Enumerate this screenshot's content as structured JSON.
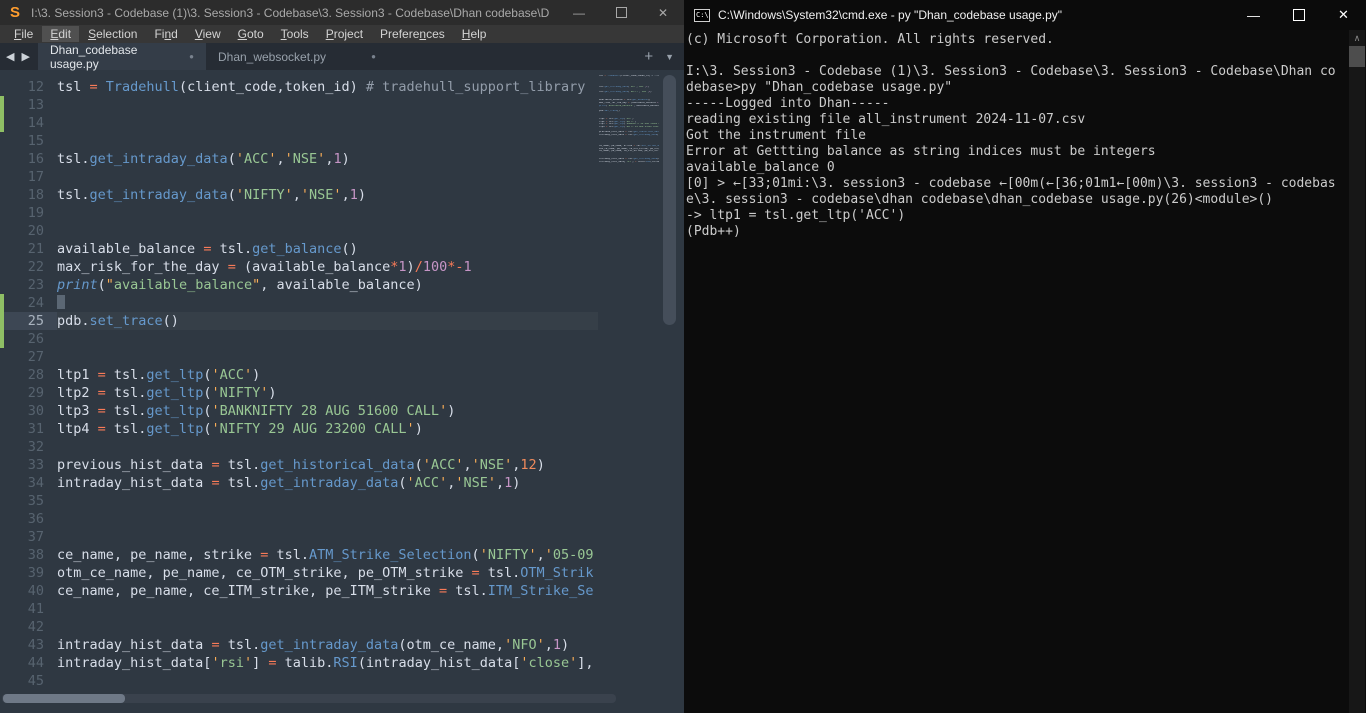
{
  "colors": {
    "editor_bg": "#2f3842",
    "editor_fg": "#d8dee9",
    "titlebar_bg": "#2c2c2c",
    "menubar_bg": "#373737",
    "menu_hl": "#505050",
    "tabbar_bg": "#262c34",
    "tab_active_bg": "#343d48",
    "tab_active_fg": "#e2e6ea",
    "tab_inactive_fg": "#98a1ab",
    "sublime_orange": "#ff9d2e",
    "fn_blue": "#6699cc",
    "string_green": "#99c794",
    "quote_orange": "#f9ae58",
    "operator_red": "#f97b58",
    "number_purple": "#c695c6",
    "number_orange": "#f08a5c",
    "comment_gray": "#939daa",
    "line_number": "#57636f",
    "gutter_green": "#8fbf65",
    "caret_gray": "#5b6774",
    "term_bg": "#0c0c0c",
    "term_fg": "#cccccc"
  },
  "editor_window": {
    "title": "I:\\3. Session3 - Codebase (1)\\3. Session3 - Codebase\\3. Session3 - Codebase\\Dhan codebase\\Dh...",
    "controls": {
      "minimize": "—",
      "maximize": "□",
      "close": "✕"
    },
    "menu": [
      {
        "label": "File",
        "u": 0
      },
      {
        "label": "Edit",
        "u": 0,
        "active": true
      },
      {
        "label": "Selection",
        "u": 0
      },
      {
        "label": "Find",
        "u": 2
      },
      {
        "label": "View",
        "u": 0
      },
      {
        "label": "Goto",
        "u": 0
      },
      {
        "label": "Tools",
        "u": 0
      },
      {
        "label": "Project",
        "u": 0
      },
      {
        "label": "Preferences",
        "u": 7
      },
      {
        "label": "Help",
        "u": 0
      }
    ],
    "nav_arrows": "◀ ▶",
    "tabs": [
      {
        "label": "Dhan_codebase usage.py",
        "modified_dot": "●",
        "active": true,
        "width": 168
      },
      {
        "label": "Dhan_websocket.py",
        "modified_dot": "●",
        "active": false,
        "width": 182
      }
    ],
    "tabbar_icons": {
      "new_tab": "+",
      "overflow": "▼"
    },
    "code_lines": [
      {
        "n": 12,
        "toks": [
          [
            "tsl ",
            "fg"
          ],
          [
            "= ",
            "op"
          ],
          [
            "Tradehull",
            "fn"
          ],
          [
            "(client_code,token_id) ",
            "fg"
          ],
          [
            "# tradehull_support_library",
            "com"
          ]
        ]
      },
      {
        "n": 13,
        "mark": true,
        "toks": []
      },
      {
        "n": 14,
        "mark": true,
        "toks": []
      },
      {
        "n": 15,
        "toks": []
      },
      {
        "n": 16,
        "toks": [
          [
            "tsl.",
            "fg"
          ],
          [
            "get_intraday_data",
            "fn"
          ],
          [
            "(",
            "fg"
          ],
          [
            "ACC",
            "s"
          ],
          [
            ",",
            "fg"
          ],
          [
            "NSE",
            "s"
          ],
          [
            ",",
            "fg"
          ],
          [
            "1",
            "num"
          ],
          [
            ")",
            "fg"
          ]
        ]
      },
      {
        "n": 17,
        "toks": []
      },
      {
        "n": 18,
        "toks": [
          [
            "tsl.",
            "fg"
          ],
          [
            "get_intraday_data",
            "fn"
          ],
          [
            "(",
            "fg"
          ],
          [
            "NIFTY",
            "s"
          ],
          [
            ",",
            "fg"
          ],
          [
            "NSE",
            "s"
          ],
          [
            ",",
            "fg"
          ],
          [
            "1",
            "num"
          ],
          [
            ")",
            "fg"
          ]
        ]
      },
      {
        "n": 19,
        "toks": []
      },
      {
        "n": 20,
        "toks": []
      },
      {
        "n": 21,
        "toks": [
          [
            "available_balance ",
            "fg"
          ],
          [
            "= ",
            "op"
          ],
          [
            "tsl.",
            "fg"
          ],
          [
            "get_balance",
            "fn"
          ],
          [
            "()",
            "fg"
          ]
        ]
      },
      {
        "n": 22,
        "toks": [
          [
            "max_risk_for_the_day ",
            "fg"
          ],
          [
            "= ",
            "op"
          ],
          [
            "(available_balance",
            "fg"
          ],
          [
            "*",
            "op"
          ],
          [
            "1",
            "num"
          ],
          [
            ")",
            "fg"
          ],
          [
            "/",
            "op"
          ],
          [
            "100",
            "num"
          ],
          [
            "*",
            "op"
          ],
          [
            "-",
            "op"
          ],
          [
            "1",
            "num"
          ]
        ]
      },
      {
        "n": 23,
        "toks": [
          [
            "print",
            "bfn"
          ],
          [
            "(",
            "fg"
          ],
          [
            "available_balance",
            "sd"
          ],
          [
            ", available_balance)",
            "fg"
          ]
        ]
      },
      {
        "n": 24,
        "mark": true,
        "cursor": true,
        "toks": []
      },
      {
        "n": 25,
        "mark": true,
        "active": true,
        "toks": [
          [
            "pdb.",
            "fg"
          ],
          [
            "set_trace",
            "fn"
          ],
          [
            "()",
            "fg"
          ]
        ]
      },
      {
        "n": 26,
        "mark": true,
        "toks": []
      },
      {
        "n": 27,
        "toks": []
      },
      {
        "n": 28,
        "toks": [
          [
            "ltp1 ",
            "fg"
          ],
          [
            "= ",
            "op"
          ],
          [
            "tsl.",
            "fg"
          ],
          [
            "get_ltp",
            "fn"
          ],
          [
            "(",
            "fg"
          ],
          [
            "ACC",
            "s"
          ],
          [
            ")",
            "fg"
          ]
        ]
      },
      {
        "n": 29,
        "toks": [
          [
            "ltp2 ",
            "fg"
          ],
          [
            "= ",
            "op"
          ],
          [
            "tsl.",
            "fg"
          ],
          [
            "get_ltp",
            "fn"
          ],
          [
            "(",
            "fg"
          ],
          [
            "NIFTY",
            "s"
          ],
          [
            ")",
            "fg"
          ]
        ]
      },
      {
        "n": 30,
        "toks": [
          [
            "ltp3 ",
            "fg"
          ],
          [
            "= ",
            "op"
          ],
          [
            "tsl.",
            "fg"
          ],
          [
            "get_ltp",
            "fn"
          ],
          [
            "(",
            "fg"
          ],
          [
            "BANKNIFTY 28 AUG 51600 CALL",
            "s"
          ],
          [
            ")",
            "fg"
          ]
        ]
      },
      {
        "n": 31,
        "toks": [
          [
            "ltp4 ",
            "fg"
          ],
          [
            "= ",
            "op"
          ],
          [
            "tsl.",
            "fg"
          ],
          [
            "get_ltp",
            "fn"
          ],
          [
            "(",
            "fg"
          ],
          [
            "NIFTY 29 AUG 23200 CALL",
            "s"
          ],
          [
            ")",
            "fg"
          ]
        ]
      },
      {
        "n": 32,
        "toks": []
      },
      {
        "n": 33,
        "toks": [
          [
            "previous_hist_data ",
            "fg"
          ],
          [
            "= ",
            "op"
          ],
          [
            "tsl.",
            "fg"
          ],
          [
            "get_historical_data",
            "fn"
          ],
          [
            "(",
            "fg"
          ],
          [
            "ACC",
            "s"
          ],
          [
            ",",
            "fg"
          ],
          [
            "NSE",
            "s"
          ],
          [
            ",",
            "fg"
          ],
          [
            "12",
            "numo"
          ],
          [
            ")",
            "fg"
          ]
        ]
      },
      {
        "n": 34,
        "toks": [
          [
            "intraday_hist_data ",
            "fg"
          ],
          [
            "= ",
            "op"
          ],
          [
            "tsl.",
            "fg"
          ],
          [
            "get_intraday_data",
            "fn"
          ],
          [
            "(",
            "fg"
          ],
          [
            "ACC",
            "s"
          ],
          [
            ",",
            "fg"
          ],
          [
            "NSE",
            "s"
          ],
          [
            ",",
            "fg"
          ],
          [
            "1",
            "num"
          ],
          [
            ")",
            "fg"
          ]
        ]
      },
      {
        "n": 35,
        "toks": []
      },
      {
        "n": 36,
        "toks": []
      },
      {
        "n": 37,
        "toks": []
      },
      {
        "n": 38,
        "toks": [
          [
            "ce_name, pe_name, strike ",
            "fg"
          ],
          [
            "= ",
            "op"
          ],
          [
            "tsl.",
            "fg"
          ],
          [
            "ATM_Strike_Selection",
            "fn"
          ],
          [
            "(",
            "fg"
          ],
          [
            "NIFTY",
            "s"
          ],
          [
            ",",
            "fg"
          ],
          [
            "'",
            "pun"
          ],
          [
            "05-09",
            "str"
          ]
        ]
      },
      {
        "n": 39,
        "toks": [
          [
            "otm_ce_name, pe_name, ce_OTM_strike, pe_OTM_strike ",
            "fg"
          ],
          [
            "= ",
            "op"
          ],
          [
            "tsl.",
            "fg"
          ],
          [
            "OTM_Strik",
            "fn"
          ]
        ]
      },
      {
        "n": 40,
        "toks": [
          [
            "ce_name, pe_name, ce_ITM_strike, pe_ITM_strike ",
            "fg"
          ],
          [
            "= ",
            "op"
          ],
          [
            "tsl.",
            "fg"
          ],
          [
            "ITM_Strike_Se",
            "fn"
          ]
        ]
      },
      {
        "n": 41,
        "toks": []
      },
      {
        "n": 42,
        "toks": []
      },
      {
        "n": 43,
        "toks": [
          [
            "intraday_hist_data ",
            "fg"
          ],
          [
            "= ",
            "op"
          ],
          [
            "tsl.",
            "fg"
          ],
          [
            "get_intraday_data",
            "fn"
          ],
          [
            "(otm_ce_name,",
            "fg"
          ],
          [
            "NFO",
            "s"
          ],
          [
            ",",
            "fg"
          ],
          [
            "1",
            "num"
          ],
          [
            ")",
            "fg"
          ]
        ]
      },
      {
        "n": 44,
        "toks": [
          [
            "intraday_hist_data[",
            "fg"
          ],
          [
            "rsi",
            "s"
          ],
          [
            "] ",
            "fg"
          ],
          [
            "= ",
            "op"
          ],
          [
            "talib.",
            "fg"
          ],
          [
            "RSI",
            "fn"
          ],
          [
            "(intraday_hist_data[",
            "fg"
          ],
          [
            "close",
            "s"
          ],
          [
            "],",
            "fg"
          ]
        ]
      },
      {
        "n": 45,
        "toks": []
      }
    ]
  },
  "terminal_window": {
    "title": "C:\\Windows\\System32\\cmd.exe - py  \"Dhan_codebase usage.py\"",
    "controls": {
      "minimize": "—",
      "maximize": "□",
      "close": "✕"
    },
    "scroll_up_glyph": "∧",
    "lines": [
      "(c) Microsoft Corporation. All rights reserved.",
      "",
      "I:\\3. Session3 - Codebase (1)\\3. Session3 - Codebase\\3. Session3 - Codebase\\Dhan co",
      "debase>py \"Dhan_codebase usage.py\"",
      "-----Logged into Dhan-----",
      "reading existing file all_instrument 2024-11-07.csv",
      "Got the instrument file",
      "Error at Gettting balance as string indices must be integers",
      "available_balance 0",
      "[0] > ←[33;01mi:\\3. session3 - codebase ←[00m(←[36;01m1←[00m)\\3. session3 - codebas",
      "e\\3. session3 - codebase\\dhan codebase\\dhan_codebase usage.py(26)<module>()",
      "-> ltp1 = tsl.get_ltp('ACC')",
      "(Pdb++)"
    ]
  }
}
